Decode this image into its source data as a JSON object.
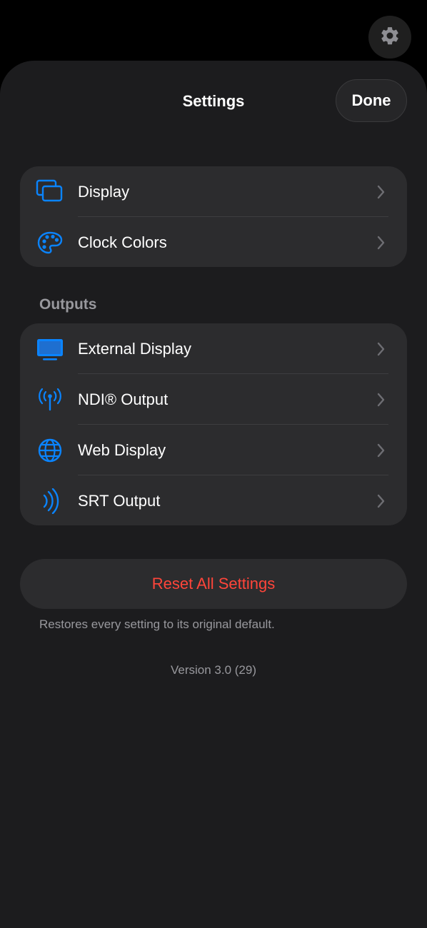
{
  "header": {
    "title": "Settings",
    "done_label": "Done"
  },
  "general": {
    "items": [
      {
        "label": "Display",
        "icon": "display-windows-icon"
      },
      {
        "label": "Clock Colors",
        "icon": "palette-icon"
      }
    ]
  },
  "outputs": {
    "header": "Outputs",
    "items": [
      {
        "label": "External Display",
        "icon": "monitor-icon"
      },
      {
        "label": "NDI® Output",
        "icon": "antenna-broadcast-icon"
      },
      {
        "label": "Web Display",
        "icon": "globe-icon"
      },
      {
        "label": "SRT Output",
        "icon": "signal-waves-icon"
      }
    ]
  },
  "reset": {
    "label": "Reset All Settings",
    "note": "Restores every setting to its original default."
  },
  "version": "Version 3.0 (29)",
  "colors": {
    "accent": "#0a84ff",
    "destructive": "#ff453a",
    "background": "#1c1c1e",
    "cell": "#2c2c2e"
  }
}
